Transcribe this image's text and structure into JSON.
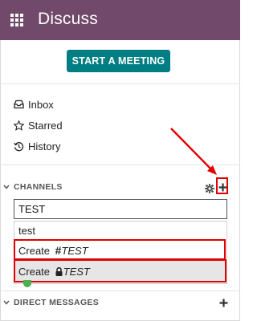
{
  "header": {
    "title": "Discuss",
    "apps_icon": "apps-grid-icon"
  },
  "actions": {
    "start_meeting": "START A MEETING"
  },
  "nav": {
    "items": [
      {
        "label": "Inbox",
        "icon": "inbox-icon"
      },
      {
        "label": "Starred",
        "icon": "star-icon"
      },
      {
        "label": "History",
        "icon": "history-icon"
      }
    ]
  },
  "channels": {
    "title": "CHANNELS",
    "search_value": "TEST",
    "suggestions": [
      {
        "label": "test"
      },
      {
        "prefix": "Create ",
        "symbol": "#",
        "name": "TEST"
      },
      {
        "prefix": "Create ",
        "symbol": "lock",
        "name": "TEST"
      }
    ]
  },
  "direct_messages": {
    "title": "DIRECT MESSAGES"
  },
  "colors": {
    "topbar": "#71496a",
    "primary_button": "#017e84",
    "annotation": "#e00000"
  }
}
